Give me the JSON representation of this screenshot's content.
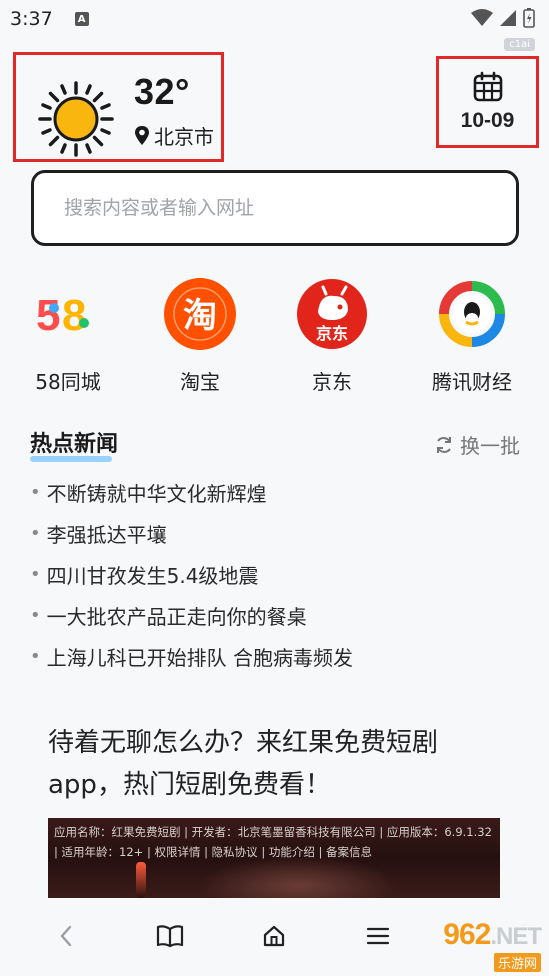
{
  "status_bar": {
    "time": "3:37",
    "notification": "A"
  },
  "watermark_top": "c1ai",
  "weather": {
    "temperature": "32°",
    "city": "北京市",
    "icon": "sun-icon"
  },
  "date": {
    "value": "10-09",
    "icon": "calendar-icon"
  },
  "search": {
    "placeholder": "搜索内容或者输入网址"
  },
  "shortcuts": [
    {
      "label": "58同城",
      "icon": "58-logo"
    },
    {
      "label": "淘宝",
      "icon": "taobao-logo"
    },
    {
      "label": "京东",
      "icon": "jd-logo"
    },
    {
      "label": "腾讯财经",
      "icon": "tencent-finance-logo"
    }
  ],
  "news": {
    "title": "热点新闻",
    "refresh_label": "换一批",
    "items": [
      "不断铸就中华文化新辉煌",
      "李强抵达平壤",
      "四川甘孜发生5.4级地震",
      "一大批农产品正走向你的餐桌",
      "上海儿科已开始排队 合胞病毒频发"
    ]
  },
  "ad": {
    "title": "待着无聊怎么办？来红果免费短剧app，热门短剧免费看！",
    "info": "应用名称：红果免费短剧 | 开发者：北京笔墨留香科技有限公司 | 应用版本：6.9.1.32 | 适用年龄：12+ | 权限详情 | 隐私协议 | 功能介绍 | 备案信息"
  },
  "bottom_nav": {
    "items": [
      "back-icon",
      "book-icon",
      "home-icon",
      "menu-icon"
    ]
  },
  "watermark": {
    "main": "962",
    "suffix": ".NET",
    "sub": "乐游网"
  },
  "colors": {
    "highlight_border": "#e02a2a",
    "sun": "#f9b60f",
    "taobao": "#ff5000",
    "jd": "#e1251b"
  }
}
